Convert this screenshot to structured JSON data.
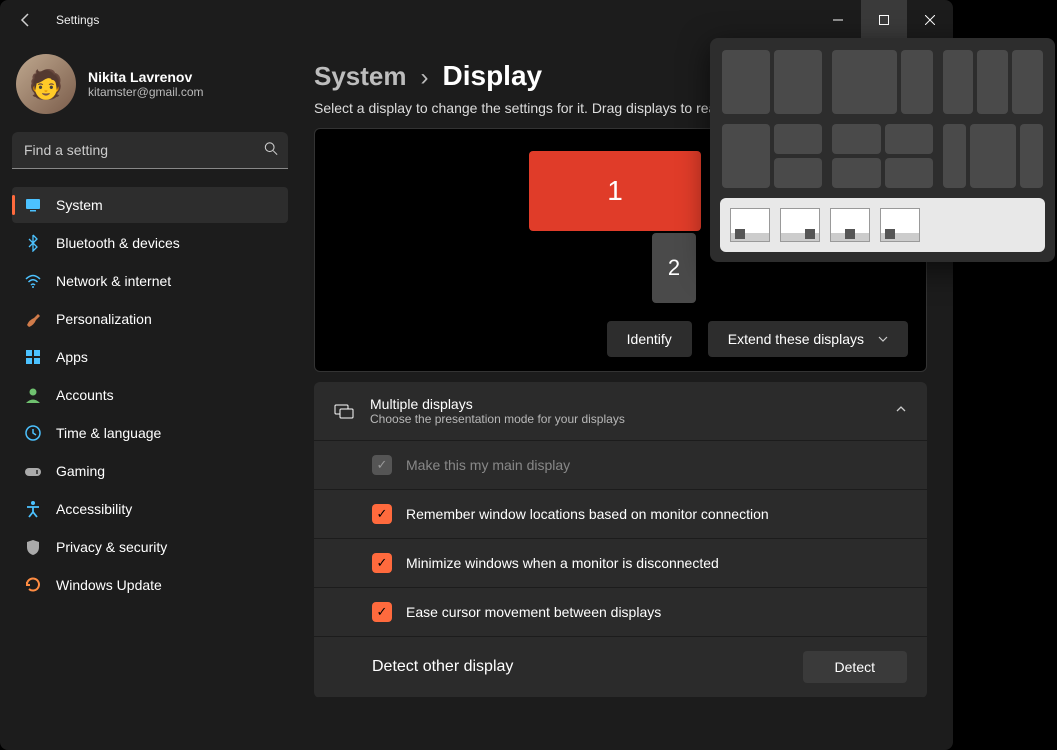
{
  "app_title": "Settings",
  "user": {
    "name": "Nikita Lavrenov",
    "email": "kitamster@gmail.com"
  },
  "search": {
    "placeholder": "Find a setting"
  },
  "nav": [
    {
      "label": "System",
      "icon": "system"
    },
    {
      "label": "Bluetooth & devices",
      "icon": "bluetooth"
    },
    {
      "label": "Network & internet",
      "icon": "wifi"
    },
    {
      "label": "Personalization",
      "icon": "brush"
    },
    {
      "label": "Apps",
      "icon": "apps"
    },
    {
      "label": "Accounts",
      "icon": "person"
    },
    {
      "label": "Time & language",
      "icon": "clock"
    },
    {
      "label": "Gaming",
      "icon": "game"
    },
    {
      "label": "Accessibility",
      "icon": "accessibility"
    },
    {
      "label": "Privacy & security",
      "icon": "shield"
    },
    {
      "label": "Windows Update",
      "icon": "update"
    }
  ],
  "breadcrumb": {
    "parent": "System",
    "current": "Display"
  },
  "subtitle": "Select a display to change the settings for it. Drag displays to rearrange them.",
  "monitors": {
    "m1": "1",
    "m2": "2"
  },
  "actions": {
    "identify": "Identify",
    "extend": "Extend these displays"
  },
  "multiple_displays": {
    "title": "Multiple displays",
    "subtitle": "Choose the presentation mode for your displays",
    "main_display": "Make this my main display",
    "remember": "Remember window locations based on monitor connection",
    "minimize": "Minimize windows when a monitor is disconnected",
    "ease_cursor": "Ease cursor movement between displays",
    "detect_label": "Detect other display",
    "detect_btn": "Detect"
  },
  "nav_icons": {
    "system": "#4cc2ff",
    "bluetooth": "#4cc2ff",
    "wifi": "#4cc2ff",
    "brush": "#d07b4a",
    "apps": "#4cc2ff",
    "person": "#6fc16f",
    "clock": "#4cc2ff",
    "game": "#aaa",
    "accessibility": "#4cc2ff",
    "shield": "#aaa",
    "update": "#ff8c42"
  }
}
